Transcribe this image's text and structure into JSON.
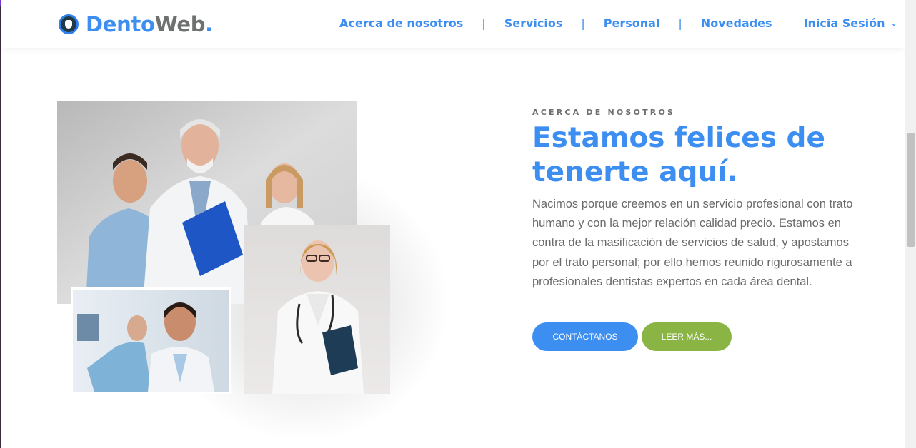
{
  "brand": {
    "part1": "Dento",
    "part2": "Web",
    "part3": ".",
    "logo_icon": "tooth-icon",
    "colors": {
      "primary": "#3d8ef1",
      "secondary": "#6f7070"
    }
  },
  "nav": {
    "items": [
      {
        "label": "Acerca de nosotros"
      },
      {
        "label": "Servicios"
      },
      {
        "label": "Personal"
      },
      {
        "label": "Novedades"
      }
    ],
    "separator": "|",
    "login": {
      "label": "Inicia Sesión",
      "icon": "chevron-down-icon"
    }
  },
  "about": {
    "eyebrow": "ACERCA DE NOSOTROS",
    "headline": "Estamos felices de tenerte aquí.",
    "body": "Nacimos porque creemos en un servicio profesional con trato humano y con la mejor relación calidad precio. Estamos en contra de la masificación de servicios de salud, y apostamos por el trato personal; por ello hemos reunido rigurosamente a profesionales dentistas expertos en cada área dental.",
    "buttons": {
      "contact": "CONTÁCTANOS",
      "more": "LEER MÁS..."
    },
    "button_colors": {
      "contact": "#3d8ef1",
      "more": "#8ab545"
    }
  }
}
